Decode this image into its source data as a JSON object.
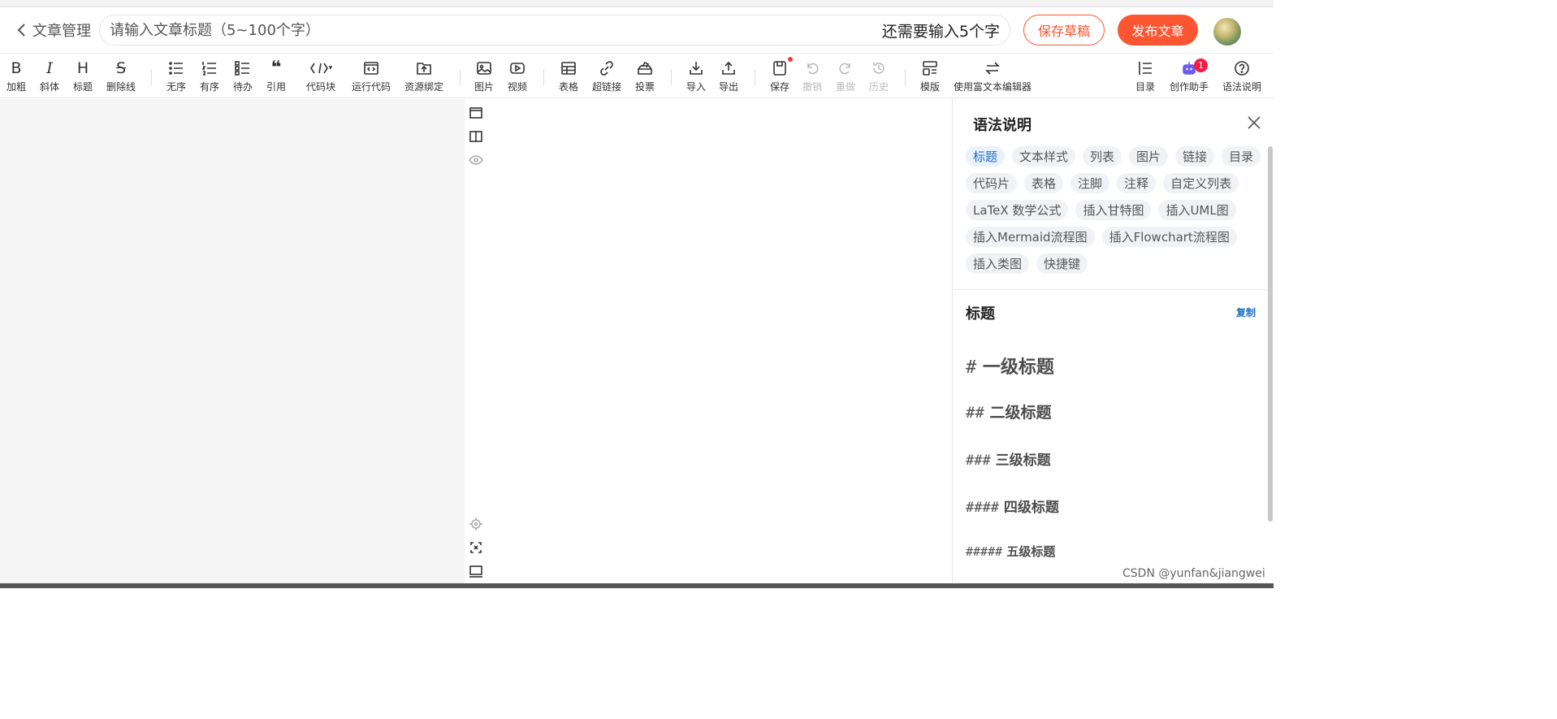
{
  "header": {
    "back_label": "文章管理",
    "title_placeholder": "请输入文章标题（5~100个字）",
    "title_value": "",
    "title_counter": "还需要输入5个字",
    "save_draft": "保存草稿",
    "publish": "发布文章"
  },
  "toolbar": {
    "bold": "加粗",
    "italic": "斜体",
    "heading": "标题",
    "strike": "删除线",
    "ul": "无序",
    "ol": "有序",
    "todo": "待办",
    "quote": "引用",
    "codeblock": "代码块",
    "runcode": "运行代码",
    "resource": "资源绑定",
    "image": "图片",
    "video": "视频",
    "table": "表格",
    "link": "超链接",
    "vote": "投票",
    "import": "导入",
    "export": "导出",
    "save": "保存",
    "undo": "撤销",
    "redo": "重做",
    "history": "历史",
    "template": "模版",
    "richtext": "使用富文本编辑器",
    "toc": "目录",
    "assistant": "创作助手",
    "assistant_badge": "1",
    "syntax": "语法说明"
  },
  "panel": {
    "title": "语法说明",
    "tags": [
      "标题",
      "文本样式",
      "列表",
      "图片",
      "链接",
      "目录",
      "代码片",
      "表格",
      "注脚",
      "注释",
      "自定义列表",
      "LaTeX 数学公式",
      "插入甘特图",
      "插入UML图",
      "插入Mermaid流程图",
      "插入Flowchart流程图",
      "插入类图",
      "快捷键"
    ],
    "active_tag": "标题",
    "section_title": "标题",
    "copy_label": "复制",
    "headings": [
      {
        "hash": "#",
        "text": "一级标题"
      },
      {
        "hash": "##",
        "text": "二级标题"
      },
      {
        "hash": "###",
        "text": "三级标题"
      },
      {
        "hash": "####",
        "text": "四级标题"
      },
      {
        "hash": "#####",
        "text": "五级标题"
      }
    ]
  },
  "watermark": "CSDN @yunfan&jiangwei",
  "colors": {
    "accent": "#fc5531",
    "link": "#1b6fc7"
  }
}
